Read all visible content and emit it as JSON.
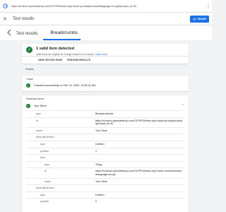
{
  "browser": {
    "url": "https://rii.demo.opencartshop.com/OCPR22/index.php?route=product/product&language=en-gb&product_id=40"
  },
  "topbar": {
    "title": "Test results",
    "share_label": "SHARE"
  },
  "header": {
    "back_label": "Test results",
    "breadcrumb": "Breadcrumbs"
  },
  "summary": {
    "title": "1 valid item detected",
    "subtitle": "Valid items are eligible for Google Search's rich results.",
    "learn_more": "Learn more",
    "view_tested_page": "VIEW TESTED PAGE",
    "preview_results": "PREVIEW RESULTS"
  },
  "details_label": "Details",
  "crawl": {
    "label": "Crawl",
    "text": "Crawled successfully on Feb 19, 2020, 10:50:31 AM"
  },
  "detected": {
    "label": "Detected items",
    "item": "Your Store",
    "rows": [
      {
        "k": "type",
        "v": "BreadcrumbList"
      },
      {
        "k": "id",
        "v": "https://rii.demo.opencartshop.com/OCPR22/index.php?route=product/product&product_id=40"
      },
      {
        "k": "name",
        "v": "Your Store"
      },
      {
        "k": "itemListElement",
        "v": ""
      },
      {
        "k": "type",
        "v": "ListItem"
      },
      {
        "k": "position",
        "v": "1"
      },
      {
        "k": "item",
        "v": ""
      },
      {
        "k": "type",
        "v": "Thing"
      },
      {
        "k": "id",
        "v": "https://rii.demo.opencartshop.com/OCPR22/index.php?route=common/home&language=en-gb"
      },
      {
        "k": "name",
        "v": "Your Store"
      },
      {
        "k": "itemListElement",
        "v": ""
      },
      {
        "k": "type",
        "v": "ListItem"
      },
      {
        "k": "position",
        "v": "2"
      }
    ]
  }
}
